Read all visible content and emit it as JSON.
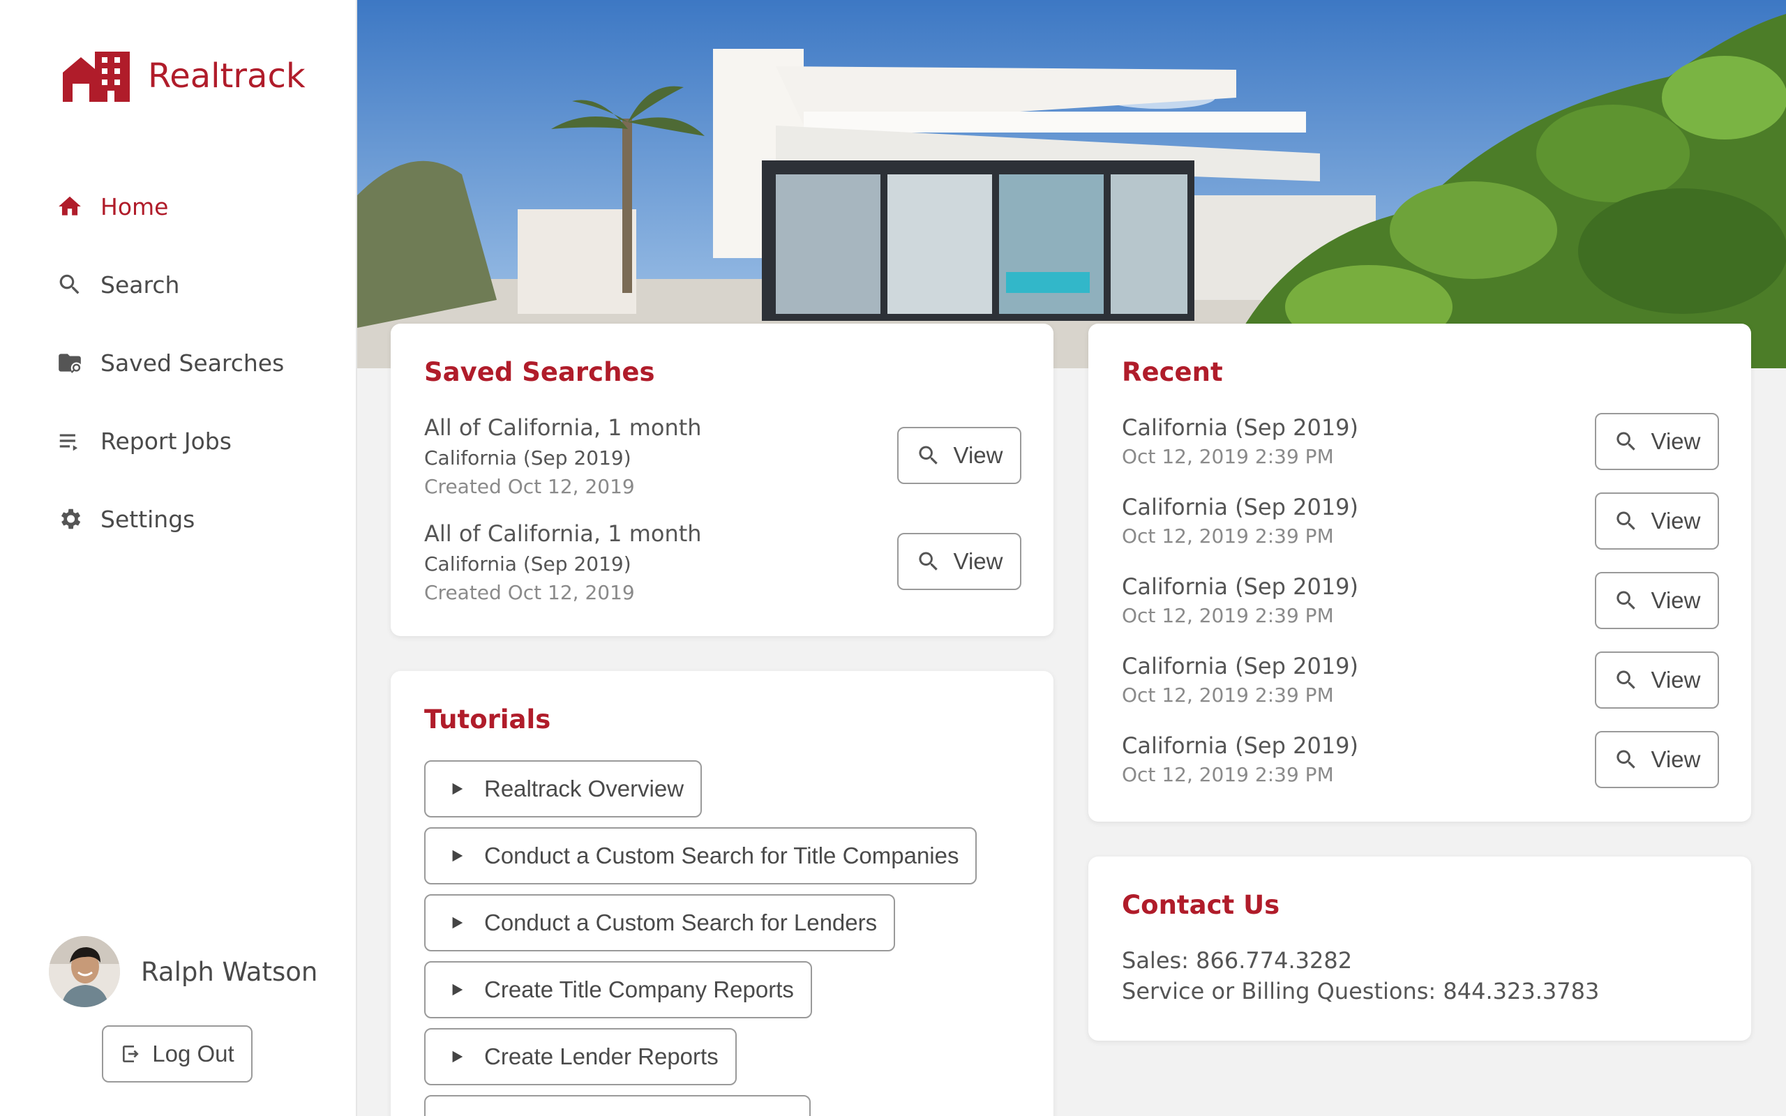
{
  "app": {
    "name": "Realtrack",
    "brand_color": "#b01c2a"
  },
  "sidebar": {
    "items": [
      {
        "label": "Home",
        "icon": "home-icon",
        "active": true
      },
      {
        "label": "Search",
        "icon": "search-icon",
        "active": false
      },
      {
        "label": "Saved Searches",
        "icon": "folder-search-icon",
        "active": false
      },
      {
        "label": "Report Jobs",
        "icon": "list-icon",
        "active": false
      },
      {
        "label": "Settings",
        "icon": "gear-icon",
        "active": false
      }
    ],
    "user": {
      "name": "Ralph Watson"
    },
    "logout_label": "Log Out"
  },
  "saved_searches": {
    "title": "Saved Searches",
    "items": [
      {
        "name": "All of California, 1 month",
        "dataset": "California (Sep 2019)",
        "created": "Created Oct 12, 2019",
        "button": "View"
      },
      {
        "name": "All of California, 1 month",
        "dataset": "California (Sep 2019)",
        "created": "Created Oct 12, 2019",
        "button": "View"
      }
    ]
  },
  "recent": {
    "title": "Recent",
    "items": [
      {
        "name": "California (Sep 2019)",
        "time": "Oct 12, 2019 2:39 PM",
        "button": "View"
      },
      {
        "name": "California (Sep 2019)",
        "time": "Oct 12, 2019 2:39 PM",
        "button": "View"
      },
      {
        "name": "California (Sep 2019)",
        "time": "Oct 12, 2019 2:39 PM",
        "button": "View"
      },
      {
        "name": "California (Sep 2019)",
        "time": "Oct 12, 2019 2:39 PM",
        "button": "View"
      },
      {
        "name": "California (Sep 2019)",
        "time": "Oct 12, 2019 2:39 PM",
        "button": "View"
      }
    ]
  },
  "tutorials": {
    "title": "Tutorials",
    "items": [
      "Realtrack Overview",
      "Conduct a Custom Search for Title Companies",
      "Conduct a Custom Search for Lenders",
      "Create Title Company Reports",
      "Create Lender Reports",
      ""
    ]
  },
  "contact": {
    "title": "Contact Us",
    "sales": "Sales: 866.774.3282",
    "service": "Service or Billing Questions: 844.323.3783"
  }
}
